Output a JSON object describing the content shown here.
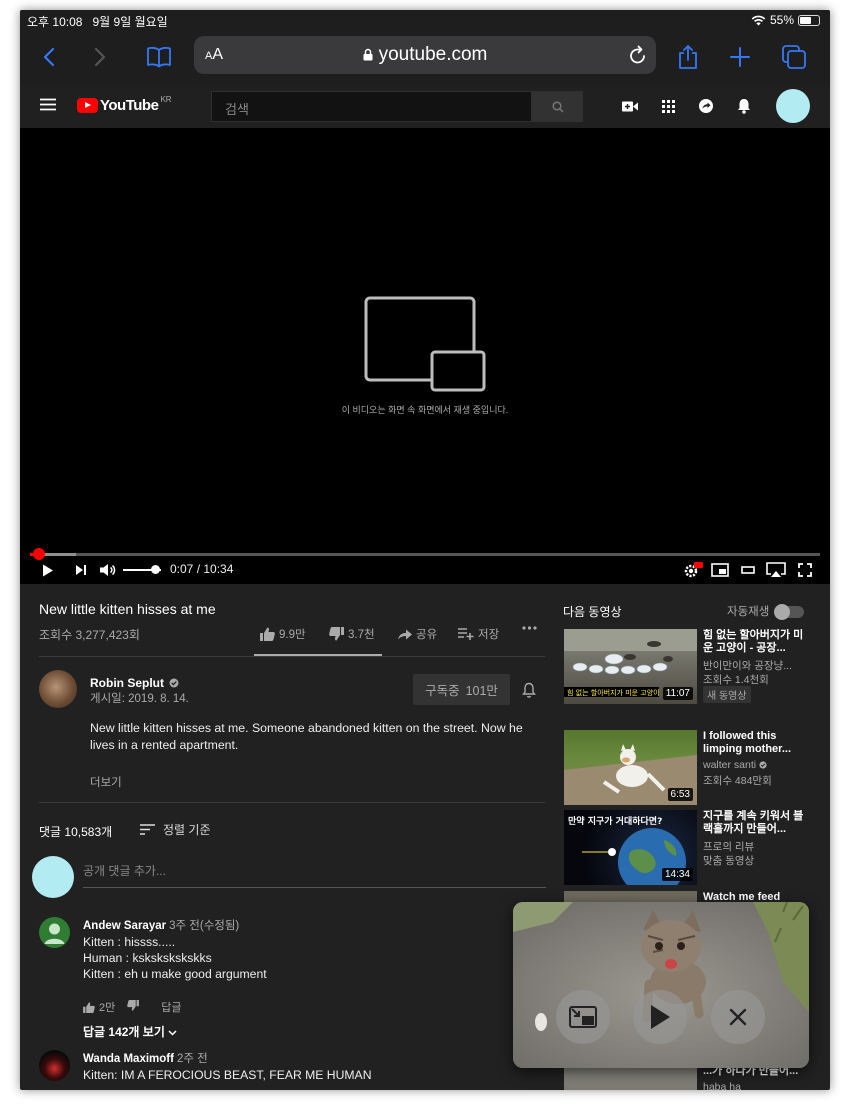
{
  "status_bar": {
    "time": "오후 10:08",
    "date": "9월 9일 월요일",
    "battery": "55%"
  },
  "safari": {
    "aa_label": "AA",
    "url": "youtube.com"
  },
  "masthead": {
    "logo_text": "YouTube",
    "country_code": "KR",
    "search_placeholder": "검색"
  },
  "player": {
    "pip_message": "이 비디오는 화면 속 화면에서 재생 중입니다.",
    "time_display": "0:07 / 10:34",
    "played_fraction": 0.011,
    "buffered_fraction": 0.058,
    "volume_fraction": 0.85
  },
  "video": {
    "title": "New little kitten hisses at me",
    "views": "조회수 3,277,423회",
    "likes": "9.9만",
    "dislikes": "3.7천",
    "share_label": "공유",
    "save_label": "저장",
    "like_ratio": 0.96
  },
  "owner": {
    "name": "Robin Seplut",
    "date": "게시일: 2019. 8. 14.",
    "subscribe_label": "구독중",
    "subscriber_count": "101만",
    "description": "New little kitten hisses at me. Someone abandoned kitten on the street. Now he lives in a rented apartment.",
    "more_label": "더보기"
  },
  "comments": {
    "count_label": "댓글 10,583개",
    "sort_label": "정렬 기준",
    "input_placeholder": "공개 댓글 추가...",
    "items": [
      {
        "author": "Andew Sarayar",
        "time": "3주 전(수정됨)",
        "text": "Kitten : hissss.....\nHuman : kskskskskskks\nKitten : eh u make good argument",
        "likes": "2만",
        "reply_label": "답글",
        "replies_label": "답글 142개 보기"
      },
      {
        "author": "Wanda Maximoff",
        "time": "2주 전",
        "text": "Kitten: IM A FEROCIOUS BEAST, FEAR ME HUMAN"
      }
    ]
  },
  "secondary": {
    "up_next_label": "다음 동영상",
    "autoplay_label": "자동재생",
    "recommendations": [
      {
        "title": "힘 없는 할아버지가 미운 고양이 - 공장...",
        "channel": "반이만이와 공장냥...",
        "meta": "조회수 1.4천회",
        "badge": "새 동영상",
        "duration": "11:07"
      },
      {
        "title": "I followed this limping mother...",
        "channel": "walter santi",
        "meta": "조회수 484만회",
        "duration": "6:53"
      },
      {
        "title": "지구를 계속 키워서 블랙홀까지 만들어...",
        "channel": "프로의 리뷰",
        "meta": "맞춤 동영상",
        "duration": "14:34",
        "thumb_caption": "만약 지구가 거대하다면?"
      },
      {
        "title": "Watch me feed",
        "channel": "",
        "meta": ""
      },
      {
        "title": "...가 하다가 만들어...",
        "channel": "haba ha"
      }
    ]
  },
  "colors": {
    "accent": "#ff0000",
    "background": "#212121",
    "avatar": "#b2ebf2"
  }
}
